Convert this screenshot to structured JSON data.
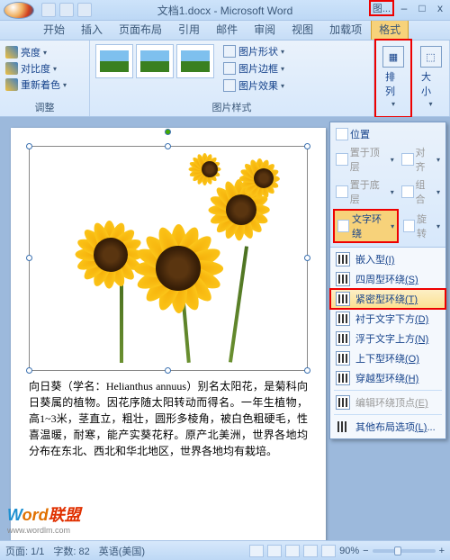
{
  "title": "文档1.docx - Microsoft Word",
  "title_context_tab": "图...",
  "win": {
    "min": "–",
    "max": "□",
    "close": "x"
  },
  "tabs": [
    "开始",
    "插入",
    "页面布局",
    "引用",
    "邮件",
    "审阅",
    "视图",
    "加载项",
    "格式"
  ],
  "ribbon": {
    "adjust": {
      "label": "调整",
      "brightness": "亮度",
      "contrast": "对比度",
      "recolor": "重新着色"
    },
    "styles": {
      "label": "图片样式",
      "shape": "图片形状",
      "border": "图片边框",
      "effects": "图片效果"
    },
    "arrange": {
      "label": "排列"
    },
    "size": {
      "label": "大小"
    }
  },
  "dropdown": {
    "position": "位置",
    "bring_front": "置于顶层",
    "align": "对齐",
    "send_back": "置于底层",
    "group": "组合",
    "text_wrap": "文字环绕",
    "rotate": "旋转",
    "items": [
      {
        "label": "嵌入型",
        "accel": "(I)"
      },
      {
        "label": "四周型环绕",
        "accel": "(S)"
      },
      {
        "label": "紧密型环绕",
        "accel": "(T)"
      },
      {
        "label": "衬于文字下方",
        "accel": "(D)"
      },
      {
        "label": "浮于文字上方",
        "accel": "(N)"
      },
      {
        "label": "上下型环绕",
        "accel": "(O)"
      },
      {
        "label": "穿越型环绕",
        "accel": "(H)"
      }
    ],
    "edit_points": "编辑环绕顶点",
    "edit_accel": "(E)",
    "more": "其他布局选项",
    "more_accel": "(L)"
  },
  "doc_text": "向日葵（学名：Helianthus annuus）别名太阳花，是菊科向日葵属的植物。因花序随太阳转动而得名。一年生植物，高1~3米，茎直立，粗壮，圆形多棱角，被白色粗硬毛，性喜温暖，耐寒，能产实葵花籽。原产北美洲，世界各地均分布在东北、西北和华北地区，世界各地均有栽培。",
  "status": {
    "page": "页面: 1/1",
    "words": "字数: 82",
    "lang": "英语(美国)",
    "zoom": "90%"
  },
  "watermark": {
    "w1": "W",
    "w2": "ord",
    "w3": "联盟",
    "url": "www.wordlm.com"
  }
}
